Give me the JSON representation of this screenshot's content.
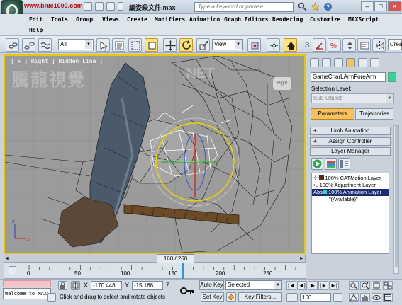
{
  "title_bar": {
    "watermark_url": "www.blue1000.com",
    "document_title": "編姿殺文件.max",
    "search_placeholder": "Type a keyword or phrase",
    "minimize": "–",
    "maximize": "□",
    "close": "✕"
  },
  "menu": {
    "items": [
      "Edit",
      "Tools",
      "Group",
      "Views",
      "Create",
      "Modifiers",
      "Animation",
      "Graph Editors",
      "Rendering",
      "Customize",
      "MAXScript",
      "Help"
    ]
  },
  "toolbar": {
    "selection_filter": "All",
    "reference_coord": "View",
    "named_selection": "Crea"
  },
  "viewport": {
    "label": "[ + ] Right ] Hidden Line ]",
    "watermark_left": "騰龍視覺",
    "watermark_right": ".NET",
    "viewcube_label": "Right"
  },
  "command_panel": {
    "object_name": "GameCharLArmForeArm",
    "object_color": "#2fd59b",
    "selection_level_label": "Selection Level:",
    "sub_object": "Sub-Object",
    "tabs": [
      "Parameters",
      "Trajectories"
    ],
    "rollouts": [
      {
        "sign": "+",
        "label": "Limb Animation"
      },
      {
        "sign": "+",
        "label": "Assign Controller"
      },
      {
        "sign": "–",
        "label": "Layer Manager"
      }
    ],
    "layers": [
      {
        "prefix": "✣",
        "swatch": "#5a2a1a",
        "text": "100% CATMotion Layer",
        "selected": false
      },
      {
        "prefix": "•L",
        "swatch": null,
        "text": "100% Adjustment Layer",
        "selected": false
      },
      {
        "prefix": "Abs",
        "swatch": "#35d3c3",
        "text": "100% Animation Layer",
        "selected": true
      },
      {
        "prefix": "",
        "swatch": null,
        "text": "\"(Available)\"",
        "selected": false
      }
    ]
  },
  "timeline": {
    "frame_display": "160 / 260",
    "current_frame": 160,
    "total_frames": 260,
    "tick_labels": [
      "0",
      "50",
      "100",
      "150",
      "200",
      "250"
    ]
  },
  "status_bar": {
    "maxscript_text": "Welcome to MAXS",
    "x_label": "X:",
    "x_value": "-170.448",
    "y_label": "Y:",
    "y_value": "-15.168",
    "z_label": "Z:",
    "prompt": "Click and drag to select and rotate objects",
    "auto_key": "Auto Key",
    "set_key": "Set Key",
    "key_mode": "Selected",
    "key_filters": "Key Filters...",
    "frame_field": "160"
  }
}
